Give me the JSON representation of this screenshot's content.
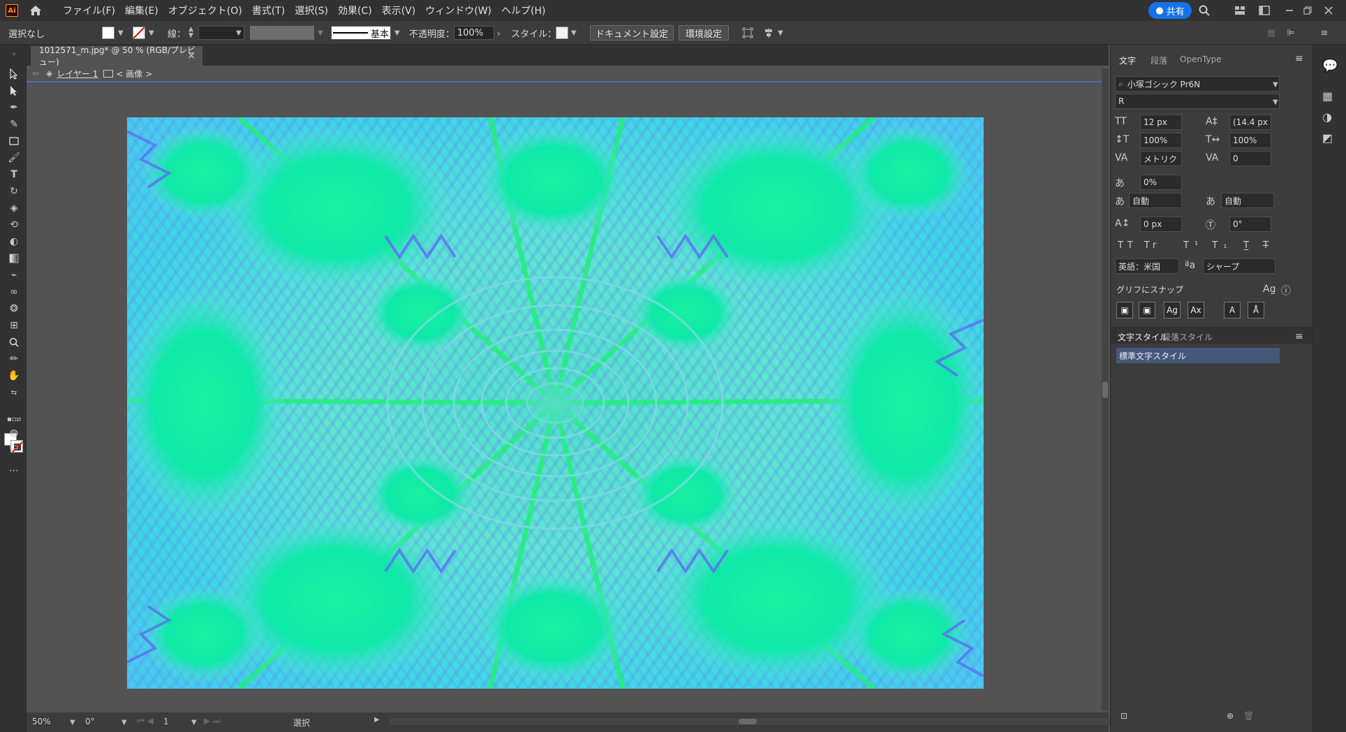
{
  "menubar": {
    "items": [
      "ファイル(F)",
      "編集(E)",
      "オブジェクト(O)",
      "書式(T)",
      "選択(S)",
      "効果(C)",
      "表示(V)",
      "ウィンドウ(W)",
      "ヘルプ(H)"
    ],
    "share_label": "共有",
    "logo_label": "Ai"
  },
  "controlbar": {
    "selection_label": "選択なし",
    "stroke_label": "線：",
    "stroke_style": "基本",
    "opacity_label": "不透明度：",
    "opacity_value": "100%",
    "style_label": "スタイル：",
    "doc_setup_label": "ドキュメント設定",
    "prefs_label": "環境設定"
  },
  "document": {
    "tab_title": "1012571_m.jpg* @ 50 % (RGB/プレビュー)",
    "close_glyph": "×",
    "breadcrumb_layer": "レイヤー 1",
    "breadcrumb_item": "< 画像 >"
  },
  "statusbar": {
    "zoom": "50%",
    "rotation": "0°",
    "artboard": "1",
    "tool": "選択"
  },
  "panel": {
    "tabs": [
      "文字",
      "段落",
      "OpenType"
    ],
    "font_family": "小塚ゴシック Pr6N",
    "font_style": "R",
    "font_size": "12 px",
    "leading": "(14.4 px",
    "vertical_scale": "100%",
    "horizontal_scale": "100%",
    "kerning": "メトリク",
    "tracking": "0",
    "tsume": "0%",
    "aki_left": "自動",
    "aki_right": "自動",
    "baseline_shift": "0 px",
    "rotation": "0°",
    "language": "英語：米国",
    "antialias": "シャープ",
    "snap_label": "グリフにスナップ",
    "style_tabs": [
      "文字スタイル",
      "段落スタイル"
    ],
    "default_style": "標準文字スタイル"
  },
  "colors": {
    "accent": "#1473e6",
    "selected_style_bg": "#45587a"
  }
}
